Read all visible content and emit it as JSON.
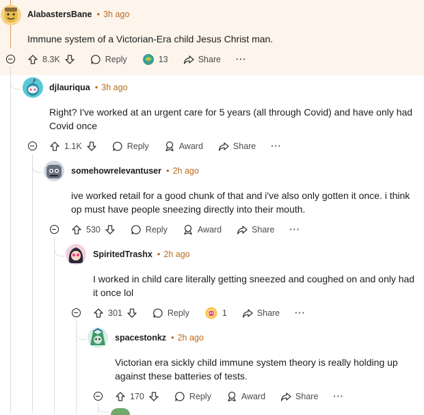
{
  "comments": [
    {
      "author": "AlabastersBane",
      "time": "3h ago",
      "text": "Immune system of a Victorian-Era child Jesus Christ man.",
      "votes": "8.3K",
      "reply_label": "Reply",
      "award_count": "13",
      "share_label": "Share",
      "more_label": "···"
    },
    {
      "author": "djlauriqua",
      "time": "3h ago",
      "text": "Right? I've worked at an urgent care for 5 years (all through Covid) and have only had Covid once",
      "votes": "1.1K",
      "reply_label": "Reply",
      "award_label": "Award",
      "share_label": "Share",
      "more_label": "···"
    },
    {
      "author": "somehowrelevantuser",
      "time": "2h ago",
      "text": "ive worked retail for a good chunk of that and i've also only gotten it once. i think op must have people sneezing directly into their mouth.",
      "votes": "530",
      "reply_label": "Reply",
      "award_label": "Award",
      "share_label": "Share",
      "more_label": "···"
    },
    {
      "author": "SpiritedTrashx",
      "time": "2h ago",
      "text": "I worked in child care literally getting sneezed and coughed on and only had it once lol",
      "votes": "301",
      "reply_label": "Reply",
      "award_count": "1",
      "share_label": "Share",
      "more_label": "···"
    },
    {
      "author": "spacestonkz",
      "time": "2h ago",
      "text": "Victorian era sickly child immune system theory is really holding up against these batteries of tests.",
      "votes": "170",
      "reply_label": "Reply",
      "award_label": "Award",
      "share_label": "Share",
      "more_label": "···"
    }
  ],
  "separator": "•",
  "colors": {
    "highlight": "#fdf5ec",
    "timestamp": "#ba6b1c",
    "thread_line": "#dcdcdc"
  },
  "icons": [
    "upvote-icon",
    "downvote-icon",
    "reply-icon",
    "award-icon",
    "share-icon",
    "collapse-icon"
  ]
}
